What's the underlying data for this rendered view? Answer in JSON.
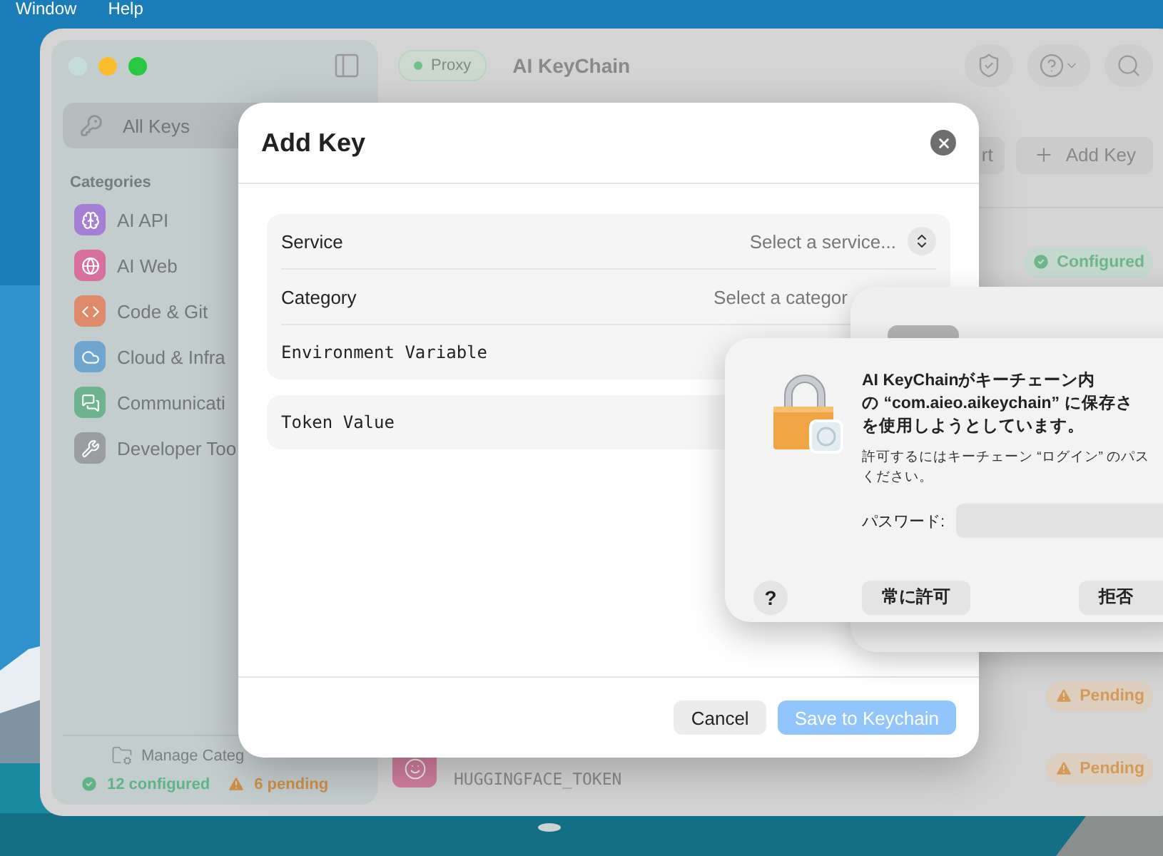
{
  "menu_bar": [
    "Window",
    "Help"
  ],
  "desktop": {
    "kind": "picture"
  },
  "app": {
    "title": "AI KeyChain",
    "proxy": {
      "label": "Proxy",
      "on": true
    }
  },
  "sidebar": {
    "items": [
      {
        "label": "All Keys",
        "selected": true
      }
    ],
    "section": "Categories",
    "categories": [
      {
        "label": "AI API",
        "color": "#a57fd6",
        "kind": "brain"
      },
      {
        "label": "AI Web",
        "color": "#d86f9d",
        "kind": "globe"
      },
      {
        "label": "Code & Git",
        "color": "#df8a6a",
        "kind": "code"
      },
      {
        "label": "Cloud & Infra",
        "color": "#6fa6cf",
        "kind": "cloud"
      },
      {
        "label": "Communicati",
        "color": "#6db48e",
        "kind": "chat"
      },
      {
        "label": "Developer Too",
        "color": "#9a9ea0",
        "kind": "tools"
      }
    ],
    "manage": "Manage Categ",
    "configured": "12 configured",
    "pending": "6 pending"
  },
  "toolbar": {
    "buttons": [
      {
        "label": "rt",
        "kind": "plain"
      },
      {
        "label": "Add Key",
        "kind": "add"
      }
    ]
  },
  "key_rows": [
    {
      "status": "Configured",
      "kind": "configured"
    },
    {
      "status": "Pending",
      "kind": "pending"
    },
    {
      "env": "HUGGINGFACE_TOKEN",
      "status": "Pending",
      "kind": "pending"
    }
  ],
  "modal": {
    "title": "Add Key",
    "fields": [
      {
        "label": "Service",
        "placeholder": "Select a service...",
        "kind": "select",
        "stepper": true
      },
      {
        "label": "Category",
        "placeholder": "Select a categor",
        "kind": "select",
        "stepper": false
      },
      {
        "label": "Environment Variable",
        "kind": "text"
      }
    ],
    "token_label": "Token Value",
    "buttons": [
      {
        "label": "Cancel",
        "kind": "secondary",
        "disabled": false
      },
      {
        "label": "Save to Keychain",
        "kind": "primary",
        "disabled": true
      }
    ]
  },
  "keychain_dialog": {
    "title_lines": [
      "AI KeyChainがキーチェーン内",
      "の “com.aieo.aikeychain” に保存さ",
      "を使用しようとしています。"
    ],
    "hint_lines": [
      "許可するにはキーチェーン “ログイン” のパス",
      "ください。"
    ],
    "password_label": "パスワード:",
    "help": "?",
    "buttons": [
      "常に許可",
      "拒否"
    ]
  }
}
